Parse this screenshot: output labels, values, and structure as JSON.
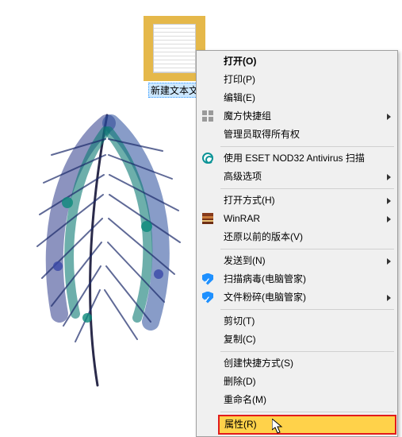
{
  "desktop": {
    "file_label": "新建文本文"
  },
  "context_menu": {
    "open": "打开(O)",
    "print": "打印(P)",
    "edit": "编辑(E)",
    "magic_group": "魔方快捷组",
    "admin_ownership": "管理员取得所有权",
    "eset_scan": "使用 ESET NOD32 Antivirus 扫描",
    "advanced_options": "高级选项",
    "open_with": "打开方式(H)",
    "winrar": "WinRAR",
    "restore_previous": "还原以前的版本(V)",
    "send_to": "发送到(N)",
    "virus_scan": "扫描病毒(电脑管家)",
    "file_shred": "文件粉碎(电脑管家)",
    "cut": "剪切(T)",
    "copy": "复制(C)",
    "create_shortcut": "创建快捷方式(S)",
    "delete": "删除(D)",
    "rename": "重命名(M)",
    "properties": "属性(R)"
  }
}
